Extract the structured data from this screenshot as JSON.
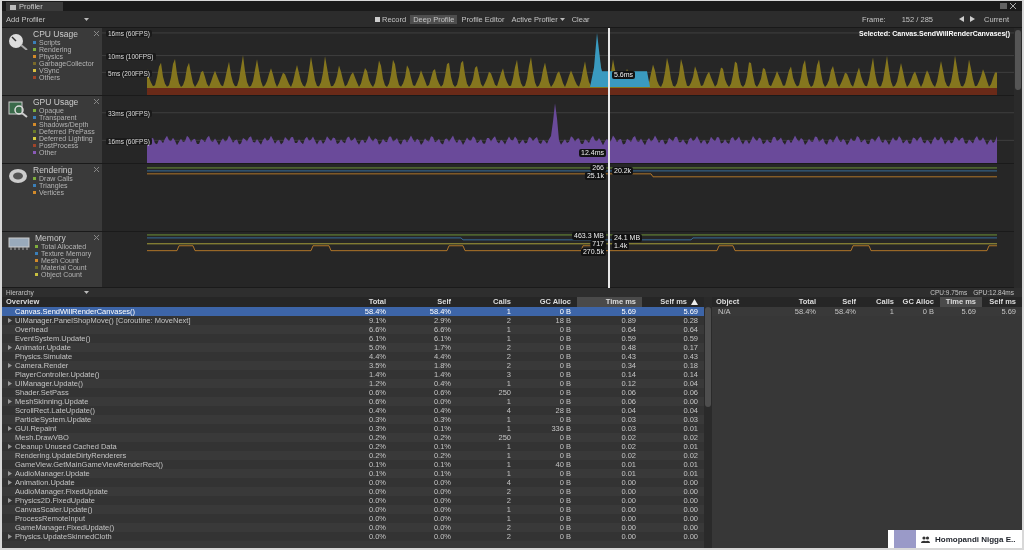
{
  "window": {
    "tab": "Profiler"
  },
  "toolbar": {
    "add_profiler": "Add Profiler",
    "buttons": [
      {
        "label": "Record",
        "kind": "record",
        "on": false
      },
      {
        "label": "Deep Profile",
        "kind": "toggle",
        "on": true
      },
      {
        "label": "Profile Editor",
        "kind": "toggle",
        "on": false
      },
      {
        "label": "Active Profiler",
        "kind": "dropdown",
        "on": false
      },
      {
        "label": "Clear",
        "kind": "toggle",
        "on": false
      }
    ],
    "frame_label": "Frame:",
    "frame_value": "152 / 285",
    "current": "Current"
  },
  "lanes": [
    {
      "kind": "cpu",
      "title": "CPU Usage",
      "legend": [
        {
          "label": "Scripts",
          "color": "#3b7fb8"
        },
        {
          "label": "Rendering",
          "color": "#7fae3c"
        },
        {
          "label": "Physics",
          "color": "#d38a2a"
        },
        {
          "label": "GarbageCollector",
          "color": "#7a6a2a"
        },
        {
          "label": "VSync",
          "color": "#d8c040"
        },
        {
          "label": "Others",
          "color": "#a0452a"
        }
      ],
      "axis_labels": [
        "16ms (60FPS)",
        "10ms (100FPS)",
        "5ms (200FPS)"
      ],
      "value_labels": [
        "5.6ms"
      ],
      "selected_label": "Selected: Canvas.SendWillRenderCanvases()"
    },
    {
      "kind": "gpu",
      "title": "GPU Usage",
      "legend": [
        {
          "label": "Opaque",
          "color": "#7fae3c"
        },
        {
          "label": "Transparent",
          "color": "#3b7fb8"
        },
        {
          "label": "Shadows/Depth",
          "color": "#d38a2a"
        },
        {
          "label": "Deferred PrePass",
          "color": "#6a7a2a"
        },
        {
          "label": "Deferred Lighting",
          "color": "#d8d040"
        },
        {
          "label": "PostProcess",
          "color": "#a0452a"
        },
        {
          "label": "Other",
          "color": "#8a5ab8"
        }
      ],
      "axis_labels": [
        "33ms (30FPS)",
        "16ms (60FPS)"
      ],
      "value_labels": [
        "12.4ms"
      ]
    },
    {
      "kind": "rendering",
      "title": "Rendering",
      "legend": [
        {
          "label": "Draw Calls",
          "color": "#7fae3c"
        },
        {
          "label": "Triangles",
          "color": "#3b7fb8"
        },
        {
          "label": "Vertices",
          "color": "#d38a2a"
        }
      ],
      "value_labels": [
        "266",
        "25.1k",
        "20.2k"
      ]
    },
    {
      "kind": "memory",
      "title": "Memory",
      "legend": [
        {
          "label": "Total Allocated",
          "color": "#7fae3c"
        },
        {
          "label": "Texture Memory",
          "color": "#3b7fb8"
        },
        {
          "label": "Mesh Count",
          "color": "#d38a2a"
        },
        {
          "label": "Material Count",
          "color": "#6a6a2a"
        },
        {
          "label": "Object Count",
          "color": "#c8c040"
        }
      ],
      "value_labels": [
        "463.3 MB",
        "717",
        "270.5k",
        "24.1 MB",
        "1.4k"
      ]
    }
  ],
  "hierarchy_bar": {
    "view": "Hierarchy",
    "cpu": "CPU:9.75ms",
    "gpu": "GPU:12.84ms"
  },
  "table": {
    "columns": [
      {
        "label": "Overview",
        "highlighted": false,
        "sorted": false
      },
      {
        "label": "Total",
        "highlighted": false,
        "sorted": false
      },
      {
        "label": "Self",
        "highlighted": false,
        "sorted": false
      },
      {
        "label": "Calls",
        "highlighted": false,
        "sorted": false
      },
      {
        "label": "GC Alloc",
        "highlighted": false,
        "sorted": false
      },
      {
        "label": "Time ms",
        "highlighted": true,
        "sorted": false
      },
      {
        "label": "Self ms",
        "highlighted": false,
        "sorted": true
      }
    ],
    "rows": [
      {
        "name": "Canvas.SendWillRenderCanvases()",
        "total": "58.4%",
        "self": "58.4%",
        "calls": "1",
        "gc_alloc": "0 B",
        "time_ms": "5.69",
        "self_ms": "5.69",
        "expandable": false,
        "selected": true
      },
      {
        "name": "UIManager.PanelShopMove() [Coroutine: MoveNext]",
        "total": "9.1%",
        "self": "2.9%",
        "calls": "2",
        "gc_alloc": "18 B",
        "time_ms": "0.89",
        "self_ms": "0.28",
        "expandable": true,
        "selected": false
      },
      {
        "name": "Overhead",
        "total": "6.6%",
        "self": "6.6%",
        "calls": "1",
        "gc_alloc": "0 B",
        "time_ms": "0.64",
        "self_ms": "0.64",
        "expandable": false,
        "selected": false
      },
      {
        "name": "EventSystem.Update()",
        "total": "6.1%",
        "self": "6.1%",
        "calls": "1",
        "gc_alloc": "0 B",
        "time_ms": "0.59",
        "self_ms": "0.59",
        "expandable": false,
        "selected": false
      },
      {
        "name": "Animator.Update",
        "total": "5.0%",
        "self": "1.7%",
        "calls": "2",
        "gc_alloc": "0 B",
        "time_ms": "0.48",
        "self_ms": "0.17",
        "expandable": true,
        "selected": false
      },
      {
        "name": "Physics.Simulate",
        "total": "4.4%",
        "self": "4.4%",
        "calls": "2",
        "gc_alloc": "0 B",
        "time_ms": "0.43",
        "self_ms": "0.43",
        "expandable": false,
        "selected": false
      },
      {
        "name": "Camera.Render",
        "total": "3.5%",
        "self": "1.8%",
        "calls": "2",
        "gc_alloc": "0 B",
        "time_ms": "0.34",
        "self_ms": "0.18",
        "expandable": true,
        "selected": false
      },
      {
        "name": "PlayerController.Update()",
        "total": "1.4%",
        "self": "1.4%",
        "calls": "3",
        "gc_alloc": "0 B",
        "time_ms": "0.14",
        "self_ms": "0.14",
        "expandable": false,
        "selected": false
      },
      {
        "name": "UIManager.Update()",
        "total": "1.2%",
        "self": "0.4%",
        "calls": "1",
        "gc_alloc": "0 B",
        "time_ms": "0.12",
        "self_ms": "0.04",
        "expandable": true,
        "selected": false
      },
      {
        "name": "Shader.SetPass",
        "total": "0.6%",
        "self": "0.6%",
        "calls": "250",
        "gc_alloc": "0 B",
        "time_ms": "0.06",
        "self_ms": "0.06",
        "expandable": false,
        "selected": false
      },
      {
        "name": "MeshSkinning.Update",
        "total": "0.6%",
        "self": "0.0%",
        "calls": "1",
        "gc_alloc": "0 B",
        "time_ms": "0.06",
        "self_ms": "0.00",
        "expandable": true,
        "selected": false
      },
      {
        "name": "ScrollRect.LateUpdate()",
        "total": "0.4%",
        "self": "0.4%",
        "calls": "4",
        "gc_alloc": "28 B",
        "time_ms": "0.04",
        "self_ms": "0.04",
        "expandable": false,
        "selected": false
      },
      {
        "name": "ParticleSystem.Update",
        "total": "0.3%",
        "self": "0.3%",
        "calls": "1",
        "gc_alloc": "0 B",
        "time_ms": "0.03",
        "self_ms": "0.03",
        "expandable": false,
        "selected": false
      },
      {
        "name": "GUI.Repaint",
        "total": "0.3%",
        "self": "0.1%",
        "calls": "1",
        "gc_alloc": "336 B",
        "time_ms": "0.03",
        "self_ms": "0.01",
        "expandable": true,
        "selected": false
      },
      {
        "name": "Mesh.DrawVBO",
        "total": "0.2%",
        "self": "0.2%",
        "calls": "250",
        "gc_alloc": "0 B",
        "time_ms": "0.02",
        "self_ms": "0.02",
        "expandable": false,
        "selected": false
      },
      {
        "name": "Cleanup Unused Cached Data",
        "total": "0.2%",
        "self": "0.1%",
        "calls": "1",
        "gc_alloc": "0 B",
        "time_ms": "0.02",
        "self_ms": "0.01",
        "expandable": true,
        "selected": false
      },
      {
        "name": "Rendering.UpdateDirtyRenderers",
        "total": "0.2%",
        "self": "0.2%",
        "calls": "1",
        "gc_alloc": "0 B",
        "time_ms": "0.02",
        "self_ms": "0.02",
        "expandable": false,
        "selected": false
      },
      {
        "name": "GameView.GetMainGameViewRenderRect()",
        "total": "0.1%",
        "self": "0.1%",
        "calls": "1",
        "gc_alloc": "40 B",
        "time_ms": "0.01",
        "self_ms": "0.01",
        "expandable": false,
        "selected": false
      },
      {
        "name": "AudioManager.Update",
        "total": "0.1%",
        "self": "0.1%",
        "calls": "1",
        "gc_alloc": "0 B",
        "time_ms": "0.01",
        "self_ms": "0.01",
        "expandable": true,
        "selected": false
      },
      {
        "name": "Animation.Update",
        "total": "0.0%",
        "self": "0.0%",
        "calls": "4",
        "gc_alloc": "0 B",
        "time_ms": "0.00",
        "self_ms": "0.00",
        "expandable": true,
        "selected": false
      },
      {
        "name": "AudioManager.FixedUpdate",
        "total": "0.0%",
        "self": "0.0%",
        "calls": "2",
        "gc_alloc": "0 B",
        "time_ms": "0.00",
        "self_ms": "0.00",
        "expandable": false,
        "selected": false
      },
      {
        "name": "Physics2D.FixedUpdate",
        "total": "0.0%",
        "self": "0.0%",
        "calls": "2",
        "gc_alloc": "0 B",
        "time_ms": "0.00",
        "self_ms": "0.00",
        "expandable": true,
        "selected": false
      },
      {
        "name": "CanvasScaler.Update()",
        "total": "0.0%",
        "self": "0.0%",
        "calls": "1",
        "gc_alloc": "0 B",
        "time_ms": "0.00",
        "self_ms": "0.00",
        "expandable": false,
        "selected": false
      },
      {
        "name": "ProcessRemoteInput",
        "total": "0.0%",
        "self": "0.0%",
        "calls": "1",
        "gc_alloc": "0 B",
        "time_ms": "0.00",
        "self_ms": "0.00",
        "expandable": false,
        "selected": false
      },
      {
        "name": "GameManager.FixedUpdate()",
        "total": "0.0%",
        "self": "0.0%",
        "calls": "2",
        "gc_alloc": "0 B",
        "time_ms": "0.00",
        "self_ms": "0.00",
        "expandable": false,
        "selected": false
      },
      {
        "name": "Physics.UpdateSkinnedCloth",
        "total": "0.0%",
        "self": "0.0%",
        "calls": "2",
        "gc_alloc": "0 B",
        "time_ms": "0.00",
        "self_ms": "0.00",
        "expandable": true,
        "selected": false
      }
    ]
  },
  "object_table": {
    "columns": [
      {
        "label": "Object",
        "highlighted": false
      },
      {
        "label": "Total",
        "highlighted": false
      },
      {
        "label": "Self",
        "highlighted": false
      },
      {
        "label": "Calls",
        "highlighted": false
      },
      {
        "label": "GC Alloc",
        "highlighted": false
      },
      {
        "label": "Time ms",
        "highlighted": true
      },
      {
        "label": "Self ms",
        "highlighted": false
      }
    ],
    "rows": [
      {
        "cells": [
          "N/A",
          "58.4%",
          "58.4%",
          "1",
          "0 B",
          "5.69",
          "5.69"
        ]
      }
    ]
  },
  "chat_popup": {
    "name": "Homopandi Nigga E.."
  }
}
